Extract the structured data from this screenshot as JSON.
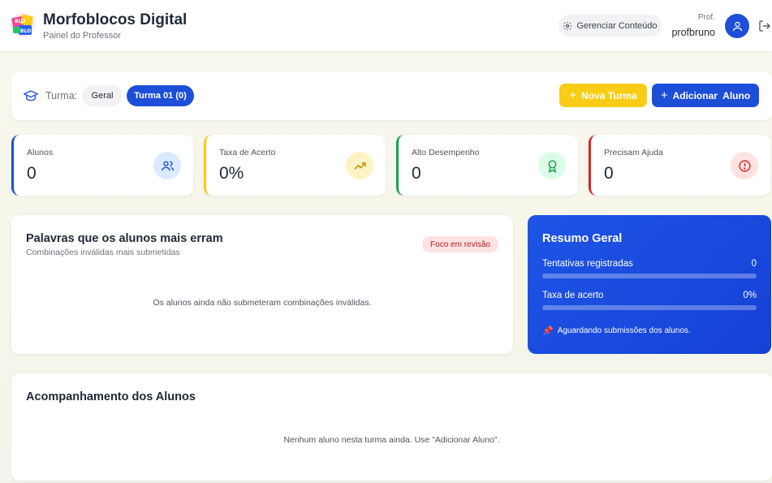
{
  "header": {
    "title": "Morfoblocos Digital",
    "subtitle": "Painel do Professor",
    "logo_icon": "morfoblocos-logo",
    "manage_label": "Gerenciar Conteúdo",
    "prof_label": "Prof.",
    "prof_name": "profbruno"
  },
  "class_bar": {
    "label": "Turma:",
    "pills": [
      {
        "label": "Geral",
        "active": false
      },
      {
        "label": "Turma 01 (0)",
        "active": true
      }
    ],
    "new_class_label": "Nova Turma",
    "add_student_label": "Adicionar  Aluno"
  },
  "stats": [
    {
      "label": "Alunos",
      "value": "0",
      "color": "#1d4ed8",
      "icon": "users-icon"
    },
    {
      "label": "Taxa de Acerto",
      "value": "0%",
      "color": "#facc15",
      "icon": "trending-up-icon"
    },
    {
      "label": "Alto Desempenho",
      "value": "0",
      "color": "#16a34a",
      "icon": "award-icon"
    },
    {
      "label": "Precisam Ajuda",
      "value": "0",
      "color": "#dc2626",
      "icon": "alert-icon"
    }
  ],
  "words": {
    "title": "Palavras que os alunos mais erram",
    "subtitle": "Combinações inválidas mais submetidas",
    "badge": "Foco em revisão",
    "empty": "Os alunos ainda não submeteram combinações inválidas."
  },
  "summary": {
    "title": "Resumo Geral",
    "rows": [
      {
        "label": "Tentativas registradas",
        "value": "0",
        "fill": 0
      },
      {
        "label": "Taxa de acerto",
        "value": "0%",
        "fill": 0
      }
    ],
    "note": "Aguardando submissões dos alunos."
  },
  "tracking": {
    "title": "Acompanhamento dos Alunos",
    "empty": "Nenhum aluno nesta turma ainda. Use \"Adicionar Aluno\"."
  },
  "colors": {
    "primary": "#1d4ed8",
    "accent": "#facc15"
  }
}
